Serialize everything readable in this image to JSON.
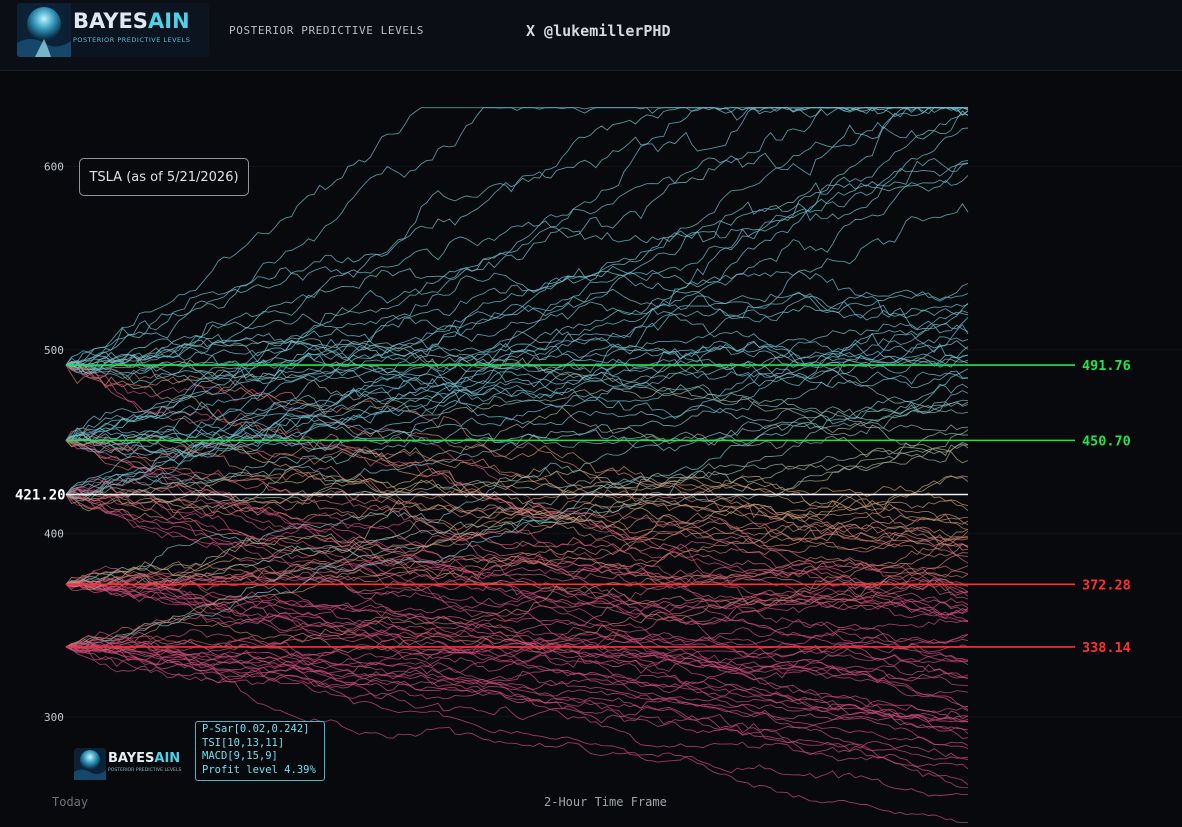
{
  "header": {
    "logo_title_main": "BAYES",
    "logo_title_accent": "AIN",
    "logo_subtitle": "POSTERIOR PREDICTIVE LEVELS",
    "nav_title": "POSTERIOR PREDICTIVE LEVELS",
    "handle": "X @lukemillerPHD"
  },
  "ticker_label": "TSLA (as of 5/21/2026)",
  "info_box": {
    "lines": [
      "P-Sar[0.02,0.242]",
      "TSI[10,13,11]",
      "MACD[9,15,9]",
      "Profit level 4.39%"
    ]
  },
  "mini_logo": {
    "title_main": "BAYES",
    "title_accent": "AIN",
    "subtitle": "POSTERIOR PREDICTIVE LEVELS"
  },
  "footer": {
    "x_start_label": "Today",
    "x_axis_label": "2-Hour Time Frame"
  },
  "chart_data": {
    "type": "line",
    "title": "",
    "xlabel": "2-Hour Time Frame",
    "ylabel": "",
    "ylim": [
      240,
      652
    ],
    "y_ticks": [
      300,
      400,
      500,
      600
    ],
    "current_price": 421.2,
    "current_price_label": "421.20",
    "levels": [
      {
        "value": 491.76,
        "label": "491.76",
        "color": "#22e54a"
      },
      {
        "value": 450.7,
        "label": "450.70",
        "color": "#22e54a"
      },
      {
        "value": 372.28,
        "label": "372.28",
        "color": "#ff3030"
      },
      {
        "value": 338.14,
        "label": "338.14",
        "color": "#ff3030"
      }
    ],
    "simulated_paths": {
      "origins": [
        491.76,
        450.7,
        421.2,
        372.28,
        338.14
      ],
      "paths_per_origin": 24,
      "steps": 160,
      "endpoint_range": [
        262,
        622
      ]
    },
    "colors": {
      "up": "#6fc3d0",
      "mid": "#c9a06a",
      "down": "#d04a78"
    }
  }
}
